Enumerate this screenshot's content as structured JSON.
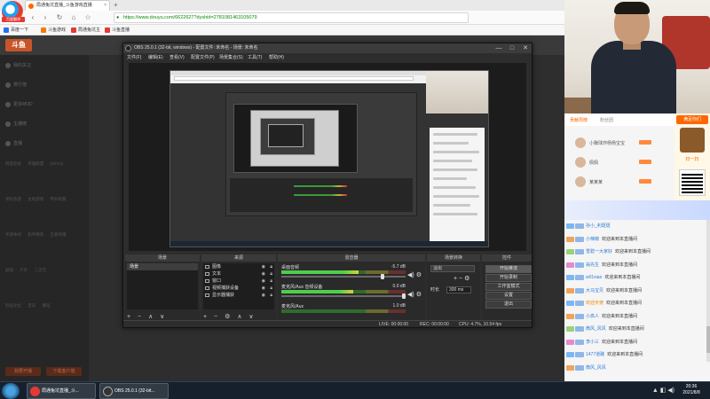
{
  "browser": {
    "logo_label": "百度翻译",
    "tab_title": "局通兔坑直播_斗鱼游戏直播",
    "tab_close": "×",
    "new_tab": "+",
    "nav": {
      "back": "‹",
      "forward": "›",
      "reload": "↻",
      "home": "⌂",
      "star": "☆"
    },
    "url": "https://www.douyu.com/6622627?dyshid=2781081463105079",
    "bookmarks": [
      "百度一下",
      "斗鱼游戏",
      "局通兔坑主",
      "斗鱼直播"
    ],
    "bookmark_colors": [
      "#2a6df4",
      "#f57c00",
      "#e53935",
      "#e53935"
    ]
  },
  "douyu": {
    "logo": "斗鱼",
    "sidebar": [
      "我的关注",
      "排行榜",
      "更多MOD",
      "主播榜",
      "直播"
    ],
    "sidebar_rows": [
      "网游竞技 英雄联盟 DOTA2",
      "单机热游 主机游戏 怀旧经典",
      "手游休闲 和平精英 王者荣耀",
      "颜值 户外 二次元",
      "科技文化 音乐 舞蹈"
    ],
    "buttons": [
      "我要开播",
      "下载客户端"
    ]
  },
  "obs": {
    "title": "OBS 25.0.1 (32-bit, windows) - 配置文件: 未命名 - 场景: 未命名",
    "window_controls": {
      "min": "—",
      "max": "□",
      "close": "✕"
    },
    "menu": [
      "文件(F)",
      "编辑(E)",
      "查看(V)",
      "配置文件(P)",
      "场景集合(S)",
      "工具(T)",
      "帮助(H)"
    ],
    "docks": {
      "scenes": {
        "title": "场景",
        "items": [
          "场景"
        ]
      },
      "sources": {
        "title": "来源",
        "items": [
          "图像",
          "文本",
          "窗口",
          "视频捕获设备",
          "显示器捕获"
        ]
      },
      "mixer": {
        "title": "混音器",
        "channels": [
          {
            "name": "桌面音频",
            "db": "-5.7 dB",
            "level": 0.62
          },
          {
            "name": "麦克风/Aux 音频设备",
            "db": "0.0 dB",
            "level": 0.58
          },
          {
            "name": "麦克风/Aux",
            "db": "1.0 dB",
            "level": 0.0
          }
        ]
      },
      "transitions": {
        "title": "场景转换",
        "selected": "淡出",
        "duration_label": "时长",
        "duration_value": "300 ms"
      },
      "controls": {
        "title": "控件",
        "buttons": [
          "开始推流",
          "开始录制",
          "工作室模式",
          "设置",
          "退出"
        ]
      }
    },
    "foot_icons": {
      "add": "+",
      "remove": "−",
      "up": "∧",
      "down": "∨",
      "gear": "⚙",
      "vol": "◀)",
      "gear2": "⚙"
    },
    "status": {
      "live": "LIVE: 00:00:00",
      "rec": "REC: 00:00:00",
      "cpu": "CPU: 4.7%, 10.54 fps"
    }
  },
  "chat": {
    "rank_tabs": [
      "贡献周榜",
      "粉丝团"
    ],
    "rank": [
      {
        "name": "小赚球炸杨杨宝宝"
      },
      {
        "name": "佩佩"
      },
      {
        "name": "某某某"
      }
    ],
    "promo": {
      "top": "满足你们",
      "bottom": "扫一扫"
    },
    "messages": [
      {
        "user": "孙小_利斑斑",
        "text": "",
        "color": "blue"
      },
      {
        "user": "小辣椒",
        "text": "欢迎来到本直播间",
        "color": "blue"
      },
      {
        "user": "雪碧一大家好",
        "text": "欢迎来到本直播间",
        "color": "blue"
      },
      {
        "user": "翁先生",
        "text": "欢迎来到本直播间",
        "color": "blue"
      },
      {
        "user": "w01xiao",
        "text": "欢迎来到本直播间",
        "color": "blue"
      },
      {
        "user": "大马宝贝",
        "text": "欢迎来到本直播间",
        "color": "blue"
      },
      {
        "user": "欢迎天使",
        "text": "欢迎来到本直播间",
        "color": "orange"
      },
      {
        "user": "小高人",
        "text": "欢迎来到本直播间",
        "color": "blue"
      },
      {
        "user": "微风_风风",
        "text": "欢迎来到本直播间",
        "color": "blue"
      },
      {
        "user": "李小三",
        "text": "欢迎来到本直播间",
        "color": "blue"
      },
      {
        "user": "1477道路",
        "text": "欢迎来到本直播间",
        "color": "blue"
      },
      {
        "user": "微风_风风",
        "text": "",
        "color": "blue"
      }
    ]
  },
  "taskbar": {
    "tasks": [
      "局通兔坑直播_斗...",
      "OBS 25.0.1 (32-bit..."
    ],
    "task_colors": [
      "#e53935",
      "#333333"
    ],
    "tray": "▲ ◧ ◀)",
    "time": "20:36",
    "date": "2021/8/8"
  }
}
